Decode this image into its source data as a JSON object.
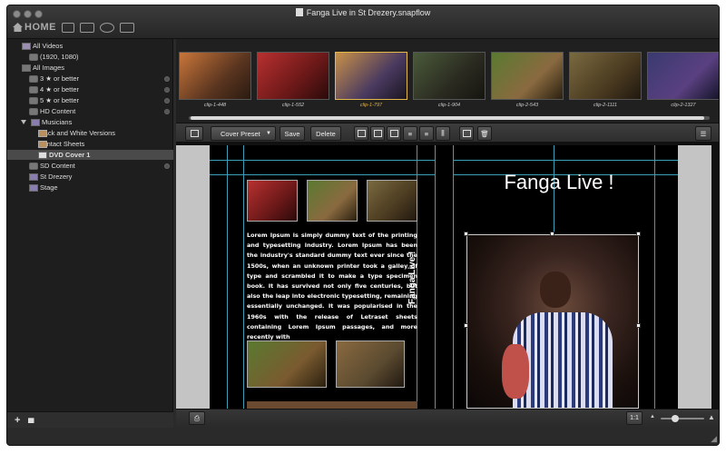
{
  "window": {
    "title": "Fanga Live in St Drezery.snapflow"
  },
  "toolbar": {
    "home_label": "HOME"
  },
  "sidebar": {
    "items": [
      {
        "label": "All Videos"
      },
      {
        "label": "(1920, 1080)"
      },
      {
        "label": "All Images"
      },
      {
        "label": "3 ★ or better"
      },
      {
        "label": "4 ★ or better"
      },
      {
        "label": "5 ★ or better"
      },
      {
        "label": "HD Content"
      },
      {
        "label": "Musicians"
      },
      {
        "label": "Black and White Versions"
      },
      {
        "label": "Contact Sheets"
      },
      {
        "label": "DVD Cover 1"
      },
      {
        "label": "SD Content"
      },
      {
        "label": "St Drezery"
      },
      {
        "label": "Stage"
      }
    ],
    "add_label": "+",
    "stats_label": "▮▮▮"
  },
  "filmstrip": {
    "clips": [
      {
        "label": "clip-1-448"
      },
      {
        "label": "clip-1-552"
      },
      {
        "label": "clip-1-797"
      },
      {
        "label": "clip-1-904"
      },
      {
        "label": "clip-2-543"
      },
      {
        "label": "clip-2-1111"
      },
      {
        "label": "clip-2-1327"
      }
    ]
  },
  "edit_toolbar": {
    "preset_label": "Cover Preset",
    "save_label": "Save",
    "delete_label": "Delete"
  },
  "canvas": {
    "title_text": "Fanga Live !",
    "spine_text": "Fanga Live !",
    "body_text": "Lorem Ipsum is simply dummy text of the printing and typesetting industry. Lorem Ipsum has been the industry's standard dummy text ever since the 1500s, when an unknown printer took a galley of type and scrambled it to make a type specimen book. It has survived not only five centuries, but also the leap into electronic typesetting, remaining essentially unchanged. It was popularised in the 1960s with the release of Letraset sheets containing Lorem Ipsum passages, and more recently with"
  },
  "bottom_bar": {
    "zoom_label": "1:1"
  }
}
